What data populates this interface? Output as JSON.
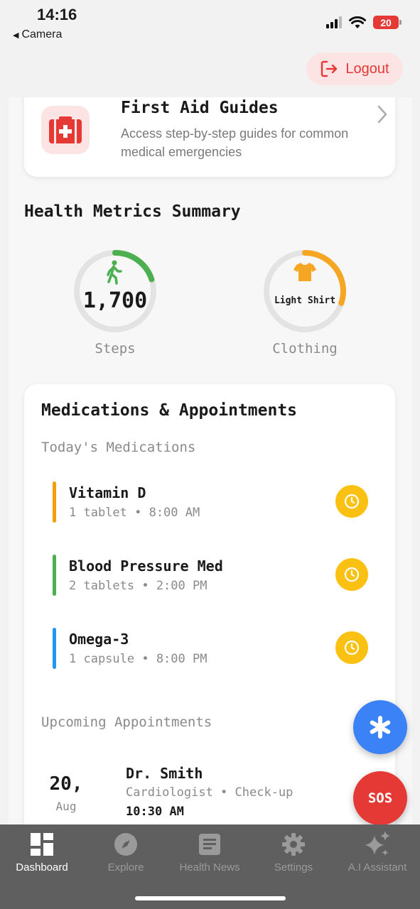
{
  "status_bar": {
    "time": "14:16",
    "back_label": "Camera",
    "battery": "20"
  },
  "header": {
    "logout_label": "Logout"
  },
  "first_aid": {
    "title": "First Aid Guides",
    "description": "Access step-by-step guides for common medical emergencies"
  },
  "metrics": {
    "title": "Health Metrics Summary",
    "steps": {
      "value": "1,700",
      "label": "Steps",
      "progress": 0.2
    },
    "clothing": {
      "value": "Light Shirt",
      "label": "Clothing",
      "progress": 0.3
    }
  },
  "meds_appts": {
    "title": "Medications & Appointments",
    "meds_header": "Today's Medications",
    "meds": [
      {
        "name": "Vitamin D",
        "detail": "1 tablet • 8:00 AM",
        "color": "#f59e0b"
      },
      {
        "name": "Blood Pressure Med",
        "detail": "2 tablets • 2:00 PM",
        "color": "#4caf50"
      },
      {
        "name": "Omega-3",
        "detail": "1 capsule • 8:00 PM",
        "color": "#2196f3"
      }
    ],
    "appts_header": "Upcoming Appointments",
    "appointments": [
      {
        "day": "20,",
        "month": "Aug",
        "doctor": "Dr. Smith",
        "specialty": "Cardiologist • Check-up",
        "time": "10:30 AM"
      }
    ]
  },
  "fab": {
    "sos_label": "SOS"
  },
  "tabs": [
    {
      "label": "Dashboard",
      "icon": "dashboard-icon",
      "active": true
    },
    {
      "label": "Explore",
      "icon": "compass-icon",
      "active": false
    },
    {
      "label": "Health News",
      "icon": "news-icon",
      "active": false
    },
    {
      "label": "Settings",
      "icon": "gear-icon",
      "active": false
    },
    {
      "label": "A.I Assistant",
      "icon": "sparkle-icon",
      "active": false
    }
  ],
  "colors": {
    "accent_red": "#e53935",
    "fab_blue": "#3b82f6",
    "clock_yellow": "#fbc112",
    "steps_green": "#4caf50",
    "clothing_orange": "#f5a623"
  }
}
